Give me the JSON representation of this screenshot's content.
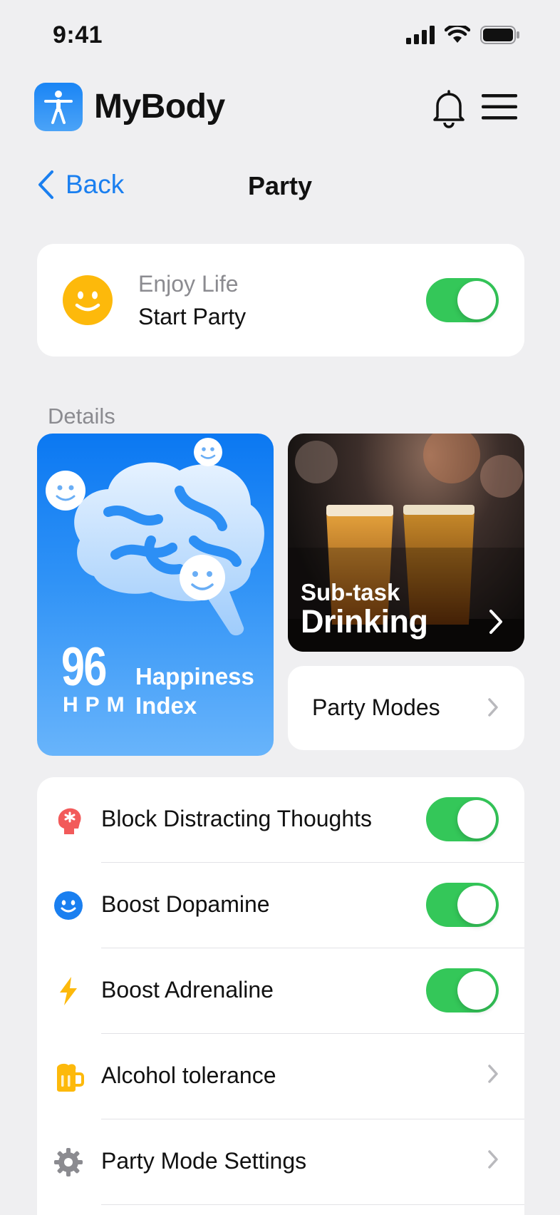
{
  "status_bar": {
    "time": "9:41"
  },
  "header": {
    "app_name": "MyBody"
  },
  "nav": {
    "back_label": "Back",
    "title": "Party"
  },
  "enjoy_card": {
    "subtitle": "Enjoy Life",
    "title": "Start Party",
    "toggle_on": true
  },
  "details": {
    "section_label": "Details",
    "happiness": {
      "value": "96",
      "unit": "HPM",
      "label": "Happiness Index"
    },
    "drinking": {
      "subtitle": "Sub-task",
      "title": "Drinking"
    },
    "party_modes": {
      "label": "Party Modes"
    }
  },
  "settings": {
    "rows": [
      {
        "label": "Block Distracting Thoughts",
        "icon": "head-icon",
        "control": "toggle",
        "on": true
      },
      {
        "label": "Boost Dopamine",
        "icon": "smiley-icon",
        "control": "toggle",
        "on": true
      },
      {
        "label": "Boost Adrenaline",
        "icon": "bolt-icon",
        "control": "toggle",
        "on": true
      },
      {
        "label": "Alcohol tolerance",
        "icon": "beer-mug-icon",
        "control": "chevron"
      },
      {
        "label": "Party Mode Settings",
        "icon": "gear-icon",
        "control": "chevron"
      }
    ]
  },
  "colors": {
    "accent": "#1a7ff0",
    "toggle_on": "#34c759",
    "smiley": "#fdb90b",
    "background": "#efeff1"
  }
}
